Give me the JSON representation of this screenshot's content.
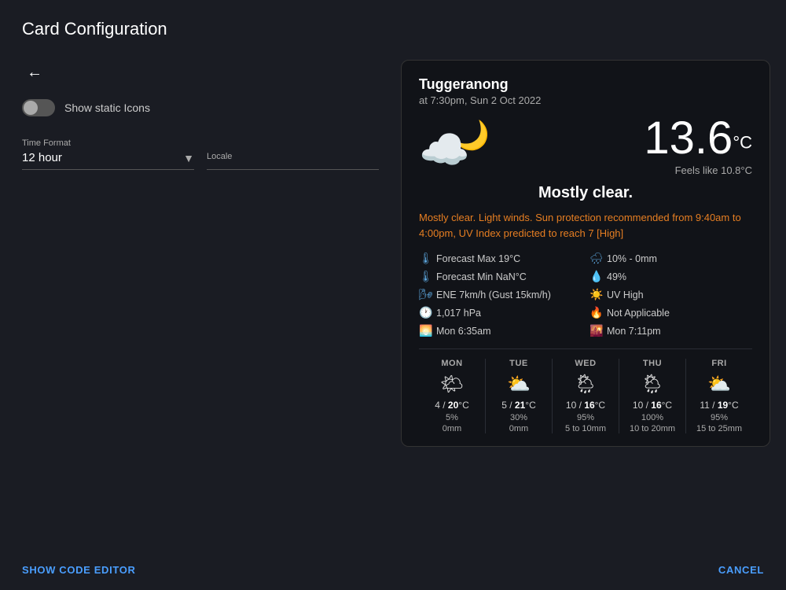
{
  "header": {
    "title": "Card Configuration"
  },
  "left": {
    "back_button": "←",
    "toggle": {
      "label": "Show static Icons",
      "checked": false
    },
    "time_format": {
      "label": "Time Format",
      "value": "12 hour"
    },
    "locale": {
      "label": "Locale",
      "value": ""
    }
  },
  "footer": {
    "code_editor": "SHOW CODE EDITOR",
    "cancel": "CANCEL"
  },
  "weather": {
    "location": "Tuggeranong",
    "datetime": "at 7:30pm, Sun 2 Oct 2022",
    "temperature": "13.6",
    "temp_unit": "°C",
    "feels_like": "Feels like 10.8°C",
    "condition": "Mostly clear.",
    "description": "Mostly clear. Light winds. Sun protection recommended from 9:40am to 4:00pm, UV Index predicted to reach 7 [High]",
    "stats": [
      {
        "icon": "🌡",
        "icon_class": "blue",
        "label": "Forecast Max 19°C"
      },
      {
        "icon": "💧",
        "icon_class": "blue",
        "label": "10% - 0mm"
      },
      {
        "icon": "🌡",
        "icon_class": "blue",
        "label": "Forecast Min NaN°C"
      },
      {
        "icon": "💧",
        "icon_class": "blue",
        "label": "49%"
      },
      {
        "icon": "🌊",
        "icon_class": "blue",
        "label": "ENE 7km/h (Gust 15km/h)"
      },
      {
        "icon": "☀",
        "icon_class": "orange",
        "label": "UV High"
      },
      {
        "icon": "⏱",
        "icon_class": "blue",
        "label": "1,017 hPa"
      },
      {
        "icon": "🔥",
        "icon_class": "orange",
        "label": "Not Applicable"
      },
      {
        "icon": "🌅",
        "icon_class": "blue",
        "label": "Mon 6:35am"
      },
      {
        "icon": "🌇",
        "icon_class": "blue",
        "label": "Mon 7:11pm"
      }
    ],
    "forecast": [
      {
        "day": "MON",
        "icon": "🌤",
        "lo": "4",
        "hi": "20",
        "pop": "5%",
        "rain": "0mm"
      },
      {
        "day": "TUE",
        "icon": "⛅",
        "lo": "5",
        "hi": "21",
        "pop": "30%",
        "rain": "0mm"
      },
      {
        "day": "WED",
        "icon": "🌦",
        "lo": "10",
        "hi": "16",
        "pop": "95%",
        "rain": "5 to 10mm"
      },
      {
        "day": "THU",
        "icon": "🌦",
        "lo": "10",
        "hi": "16",
        "pop": "100%",
        "rain": "10 to 20mm"
      },
      {
        "day": "FRI",
        "icon": "⛅",
        "lo": "11",
        "hi": "19",
        "pop": "95%",
        "rain": "15 to 25mm"
      }
    ]
  }
}
